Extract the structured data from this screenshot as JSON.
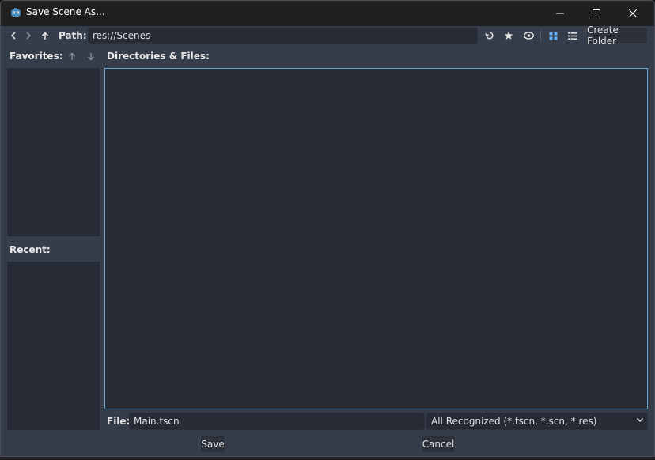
{
  "window": {
    "title": "Save Scene As...",
    "minimize_icon": "minimize-icon",
    "maximize_icon": "maximize-icon",
    "close_icon": "close-icon"
  },
  "toolbar": {
    "back_icon": "chevron-left-icon",
    "forward_icon": "chevron-right-icon",
    "up_icon": "arrow-up-icon",
    "path_label": "Path:",
    "path_value": "res://Scenes",
    "refresh_icon": "refresh-icon",
    "favorite_icon": "star-icon",
    "hidden_files_icon": "eye-icon",
    "grid_view_icon": "grid-icon",
    "list_view_icon": "list-icon",
    "create_folder_label": "Create Folder"
  },
  "sidebar": {
    "favorites_label": "Favorites:",
    "move_up_icon": "arrow-up-icon",
    "move_down_icon": "arrow-down-icon",
    "recent_label": "Recent:"
  },
  "main": {
    "files_label": "Directories & Files:"
  },
  "footer": {
    "file_label": "File:",
    "file_value": "Main.tscn",
    "filter_value": "All Recognized (*.tscn, *.scn, *.res)",
    "save_label": "Save",
    "cancel_label": "Cancel"
  },
  "colors": {
    "panel_bg": "#262b35",
    "window_bg": "#363d4a",
    "titlebar_bg": "#1f1f1f",
    "accent": "#68a7d3",
    "active_view": "#5fb2ff"
  }
}
